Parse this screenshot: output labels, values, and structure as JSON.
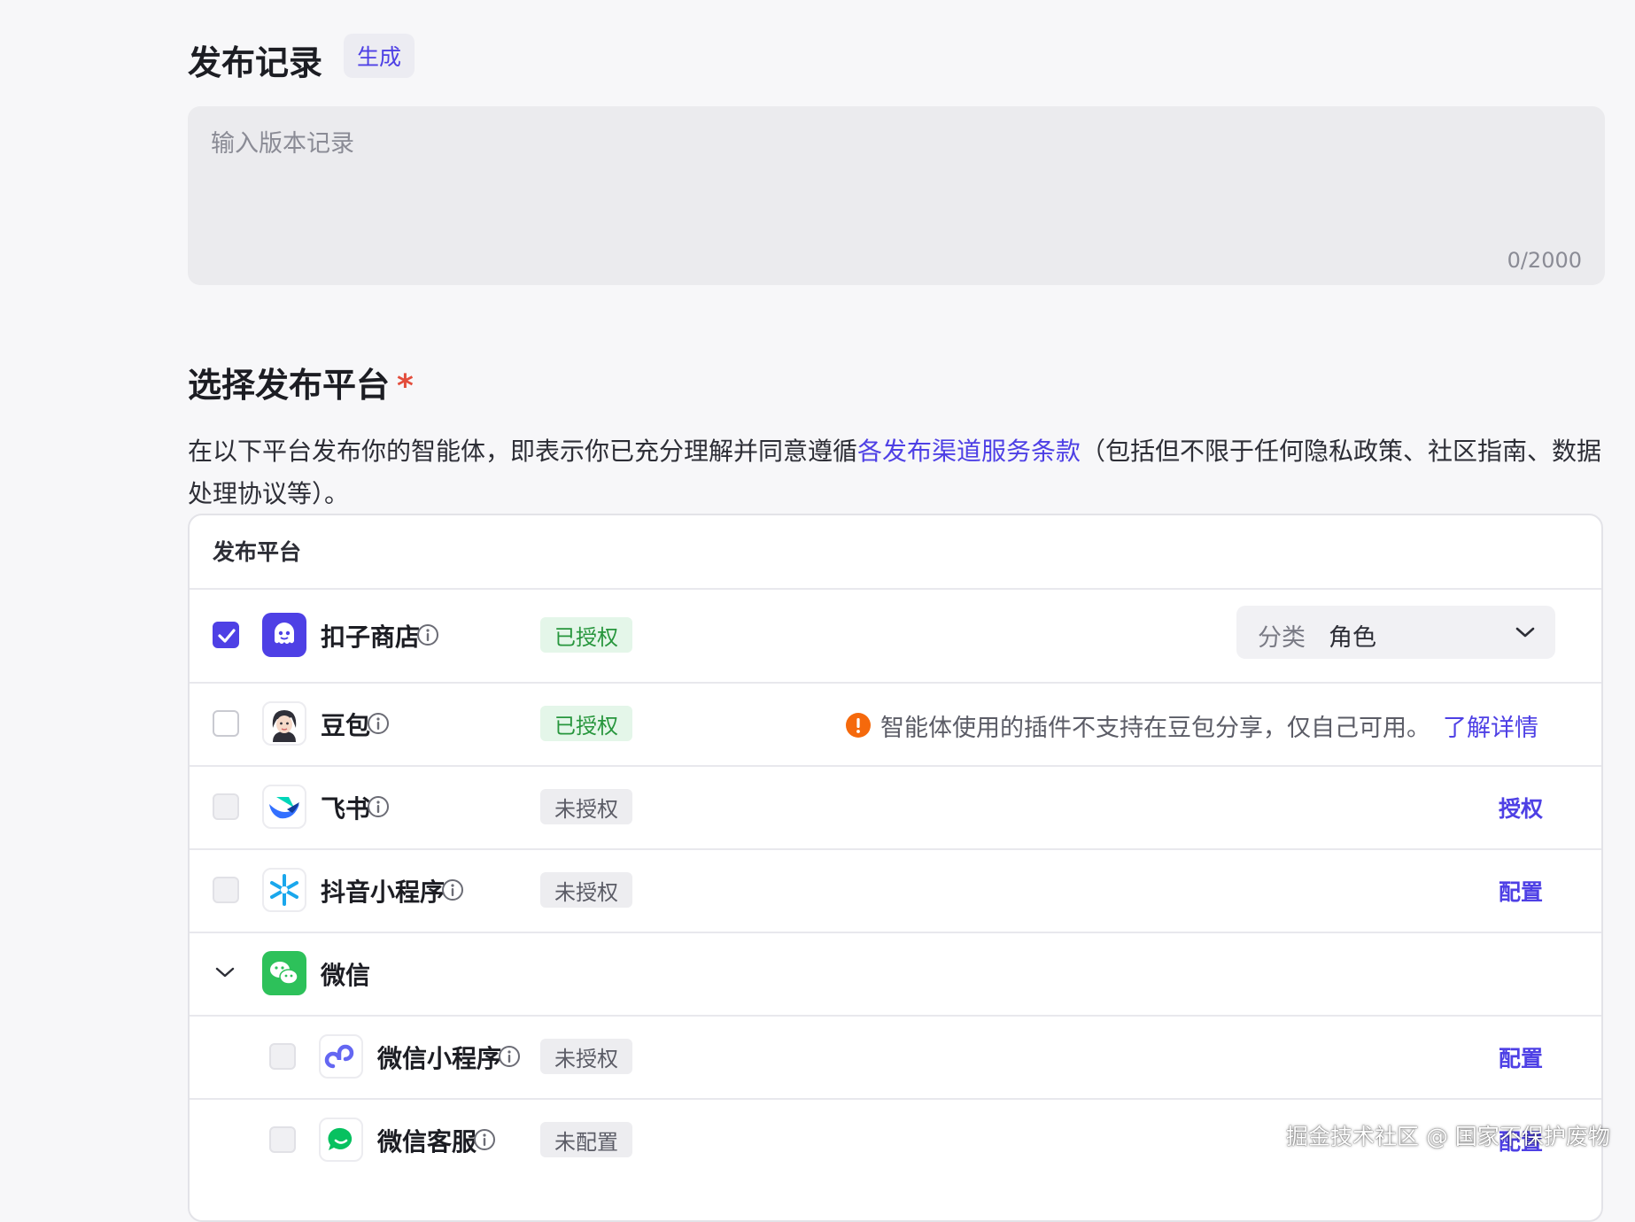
{
  "release_notes": {
    "title": "发布记录",
    "generate_label": "生成",
    "placeholder": "输入版本记录",
    "counter": "0/2000"
  },
  "platform_section": {
    "title": "选择发布平台",
    "required_mark": "*",
    "desc_before": "在以下平台发布你的智能体，即表示你已充分理解并同意遵循",
    "desc_link": "各发布渠道服务条款",
    "desc_after": "（包括但不限于任何隐私政策、社区指南、数据处理协议等）。"
  },
  "table": {
    "header": "发布平台",
    "rows": [
      {
        "name": "扣子商店",
        "checked": true,
        "status": "已授权",
        "category_label": "分类",
        "category_value": "角色"
      },
      {
        "name": "豆包",
        "checked": false,
        "status": "已授权",
        "warning": "智能体使用的插件不支持在豆包分享，仅自己可用。",
        "warning_link": "了解详情"
      },
      {
        "name": "飞书",
        "checked": false,
        "status": "未授权",
        "action": "授权"
      },
      {
        "name": "抖音小程序",
        "checked": false,
        "status": "未授权",
        "action": "配置"
      },
      {
        "name": "微信",
        "expanded": true
      },
      {
        "name": "微信小程序",
        "checked": false,
        "status": "未授权",
        "action": "配置"
      },
      {
        "name": "微信客服",
        "checked": false,
        "status": "未配置",
        "action": "配置"
      }
    ]
  },
  "watermark": "掘金技术社区 @ 国家不保护废物",
  "colors": {
    "accent": "#4e40e5",
    "authorized_bg": "#e4f6e9",
    "authorized_text": "#27963d",
    "warning": "#f5690c",
    "required": "#e34d3c"
  }
}
